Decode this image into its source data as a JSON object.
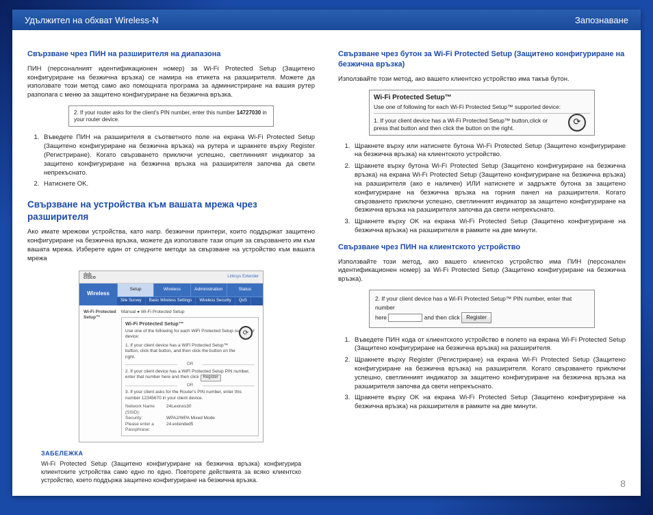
{
  "header": {
    "left": "Удължител на обхват Wireless-N",
    "right": "Запознаване"
  },
  "left": {
    "sec1_title": "Свързване чрез ПИН на разширителя на диапазона",
    "sec1_p1": "ПИН (персоналният идентификационен номер) за Wi-Fi Protected Setup (Защитено конфигуриране на безжична връзка) се намира на етикета на разширителя. Можете да използвате този метод само ако помощната програма за администриране на вашия рутер разполага с меню за защитено конфигуриране на безжична връзка.",
    "fig1_text_a": "2. If your router asks for the client's PIN number, enter this number ",
    "fig1_pin": "14727030",
    "fig1_text_b": " in your router device.",
    "ol1": [
      "Въведете ПИН на разширителя в съответното поле на екрана Wi-Fi Protected Setup (Защитено конфигуриране на безжична връзка) на рутера и щракнете върху Register (Регистриране). Когато свързването приключи успешно, светлинният индикатор за защитено конфигуриране на безжична връзка на разширителя започва да свети непрекъснато.",
      "Натиснете OK."
    ],
    "sec2_title": "Свързване на устройства към вашата мрежа чрез разширителя",
    "sec2_p1": "Ако имате мрежови устройства, като напр. безжични принтери, които поддържат защитено конфигуриране на безжична връзка, можете да използвате тази опция за свързването им към вашата мрежа. Изберете един от следните методи за свързване на устройство към вашата мрежа",
    "router": {
      "brand": "cisco",
      "brand2": "Linksys Extender",
      "side_label": "Wireless",
      "tabs": [
        "Setup",
        "Wireless",
        "Administration",
        "Status"
      ],
      "subtabs": [
        "Site Survey",
        "Basic Wireless Settings",
        "Wireless Security",
        "QoS"
      ],
      "side2": "Wi-Fi Protected Setup™",
      "radio": "Manual  ● Wi-Fi Protected Setup",
      "wps_title": "Wi-Fi Protected Setup™",
      "wps_sub": "Use one of the following for each WiFi Protected Setup supported device:",
      "wps_l1": "1. If your client device has a WiFi Protected Setup™ button, click that button, and then click the button on the right.",
      "wps_or": "OR",
      "wps_l2": "2. If your client device has a WiFi Protected Setup PIN number, enter that number here and then click",
      "reg": "Register",
      "wps_l3": "3. If your client asks for the Router's PIN number, enter this number 12345670 in your client device.",
      "net_name_l": "Network Name (SSID):",
      "net_name_v": "24Lexinxs30",
      "sec_l": "Security:",
      "sec_v": "WPA2/WPA Mixed Mode",
      "pass_l": "Please enter a Passphrase:",
      "pass_v": "24.extended5"
    },
    "note_label": "ЗАБЕЛЕЖКА",
    "note_text": "Wi-Fi Protected Setup (Защитено конфигуриране на безжична връзка) конфигурира клиентските устройства само едно по едно. Повторете действията за всяко клиентско устройство, което поддържа защитено конфигуриране на безжична връзка."
  },
  "right": {
    "sec1_title": "Свързване чрез бутон за Wi-Fi Protected Setup (Защитено конфигуриране на безжична връзка)",
    "sec1_p1": "Използвайте този метод, ако вашето клиентско устройство има такъв бутон.",
    "fig_wps": {
      "title": "Wi-Fi Protected Setup™",
      "sub": "Use one of following for each Wi-Fi Protected Setup™ supported device:",
      "text": "1. If your client device has a Wi-Fi Protected Setup™ button,click or press that button and then click the button on the right."
    },
    "ol1": [
      "Щракнете върху или натиснете бутона Wi-Fi Protected Setup (Защитено конфигуриране на безжична връзка) на клиентското устройство.",
      "Щракнете върху бутона Wi-Fi Protected Setup (Защитено конфигуриране на безжична връзка) на екрана Wi-Fi Protected Setup (Защитено конфигуриране на безжична връзка) на разширителя (ако е наличен) ИЛИ натиснете и задръжте бутона за защитено конфигуриране на безжична връзка на горния панел на разширителя. Когато свързването приключи успешно, светлинният индикатор за защитено конфигуриране на безжична връзка на разширителя започва да свети непрекъснато.",
      "Щракнете върху OK на екрана Wi-Fi Protected Setup (Защитено конфигуриране на безжична връзка) на разширителя в рамките на две минути."
    ],
    "sec2_title": "Свързване чрез ПИН на клиентското устройство",
    "sec2_p1": "Използвайте този метод, ако вашето клиентско устройство има ПИН (персонален идентификационен номер) за Wi-Fi Protected Setup (Защитено конфигуриране на безжична връзка).",
    "fig_pin": {
      "line1": "2. If your client device has a Wi-Fi Protected Setup™ PIN number, enter that number",
      "here": "here",
      "line2": "and then click",
      "reg": "Register"
    },
    "ol2": [
      "Въведете ПИН кода от клиентското устройство в полето на екрана Wi-Fi Protected Setup (Защитено конфигуриране на безжична връзка) на разширителя.",
      "Щракнете върху Register (Регистриране) на екрана Wi-Fi Protected Setup (Защитено конфигуриране на безжична връзка) на разширителя. Когато свързването приключи успешно, светлинният индикатор за защитено конфигуриране на безжична връзка на разширителя започва да свети непрекъснато.",
      "Щракнете върху OK на екрана Wi-Fi Protected Setup (Защитено конфигуриране на безжична връзка) на разширителя в рамките на две минути."
    ]
  },
  "page_num": "8"
}
